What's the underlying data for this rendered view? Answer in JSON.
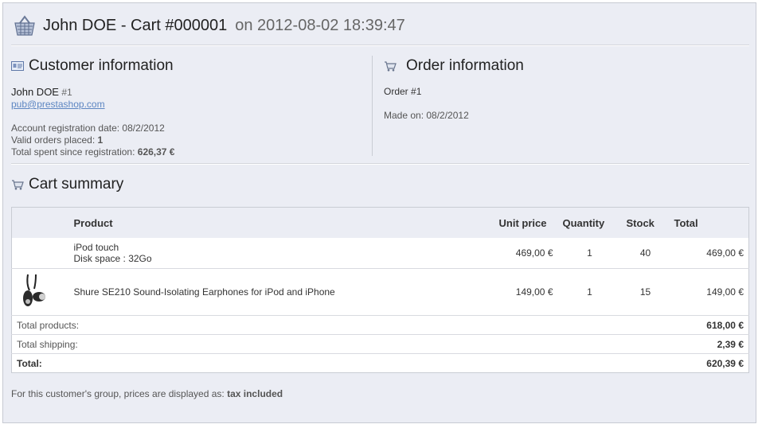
{
  "header": {
    "title": "John DOE - Cart #000001",
    "date": "on 2012-08-02 18:39:47"
  },
  "customer": {
    "section_title": "Customer information",
    "name": "John DOE",
    "id": "#1",
    "email": "pub@prestashop.com",
    "registration_label": "Account registration date:",
    "registration_value": "08/2/2012",
    "orders_label": "Valid orders placed:",
    "orders_value": "1",
    "spent_label": "Total spent since registration:",
    "spent_value": "626,37 €"
  },
  "order": {
    "section_title": "Order information",
    "order_label": "Order",
    "order_id": "#1",
    "made_on": "Made on: 08/2/2012"
  },
  "cart": {
    "section_title": "Cart summary",
    "columns": {
      "product": "Product",
      "unit_price": "Unit price",
      "quantity": "Quantity",
      "stock": "Stock",
      "total": "Total"
    },
    "rows": [
      {
        "product": "iPod touch",
        "attribute": "Disk space : 32Go",
        "unit_price": "469,00 €",
        "quantity": "1",
        "stock": "40",
        "total": "469,00 €"
      },
      {
        "product": "Shure SE210 Sound-Isolating Earphones for iPod and iPhone",
        "unit_price": "149,00 €",
        "quantity": "1",
        "stock": "15",
        "total": "149,00 €"
      }
    ],
    "totals": {
      "products_label": "Total products:",
      "products_value": "618,00 €",
      "shipping_label": "Total shipping:",
      "shipping_value": "2,39 €",
      "total_label": "Total:",
      "total_value": "620,39 €"
    }
  },
  "footer_note": {
    "text": "For this customer's group, prices are displayed as:",
    "value": "tax included"
  },
  "colors": {
    "panel_bg": "#ebedf4",
    "link": "#5d86c2"
  }
}
